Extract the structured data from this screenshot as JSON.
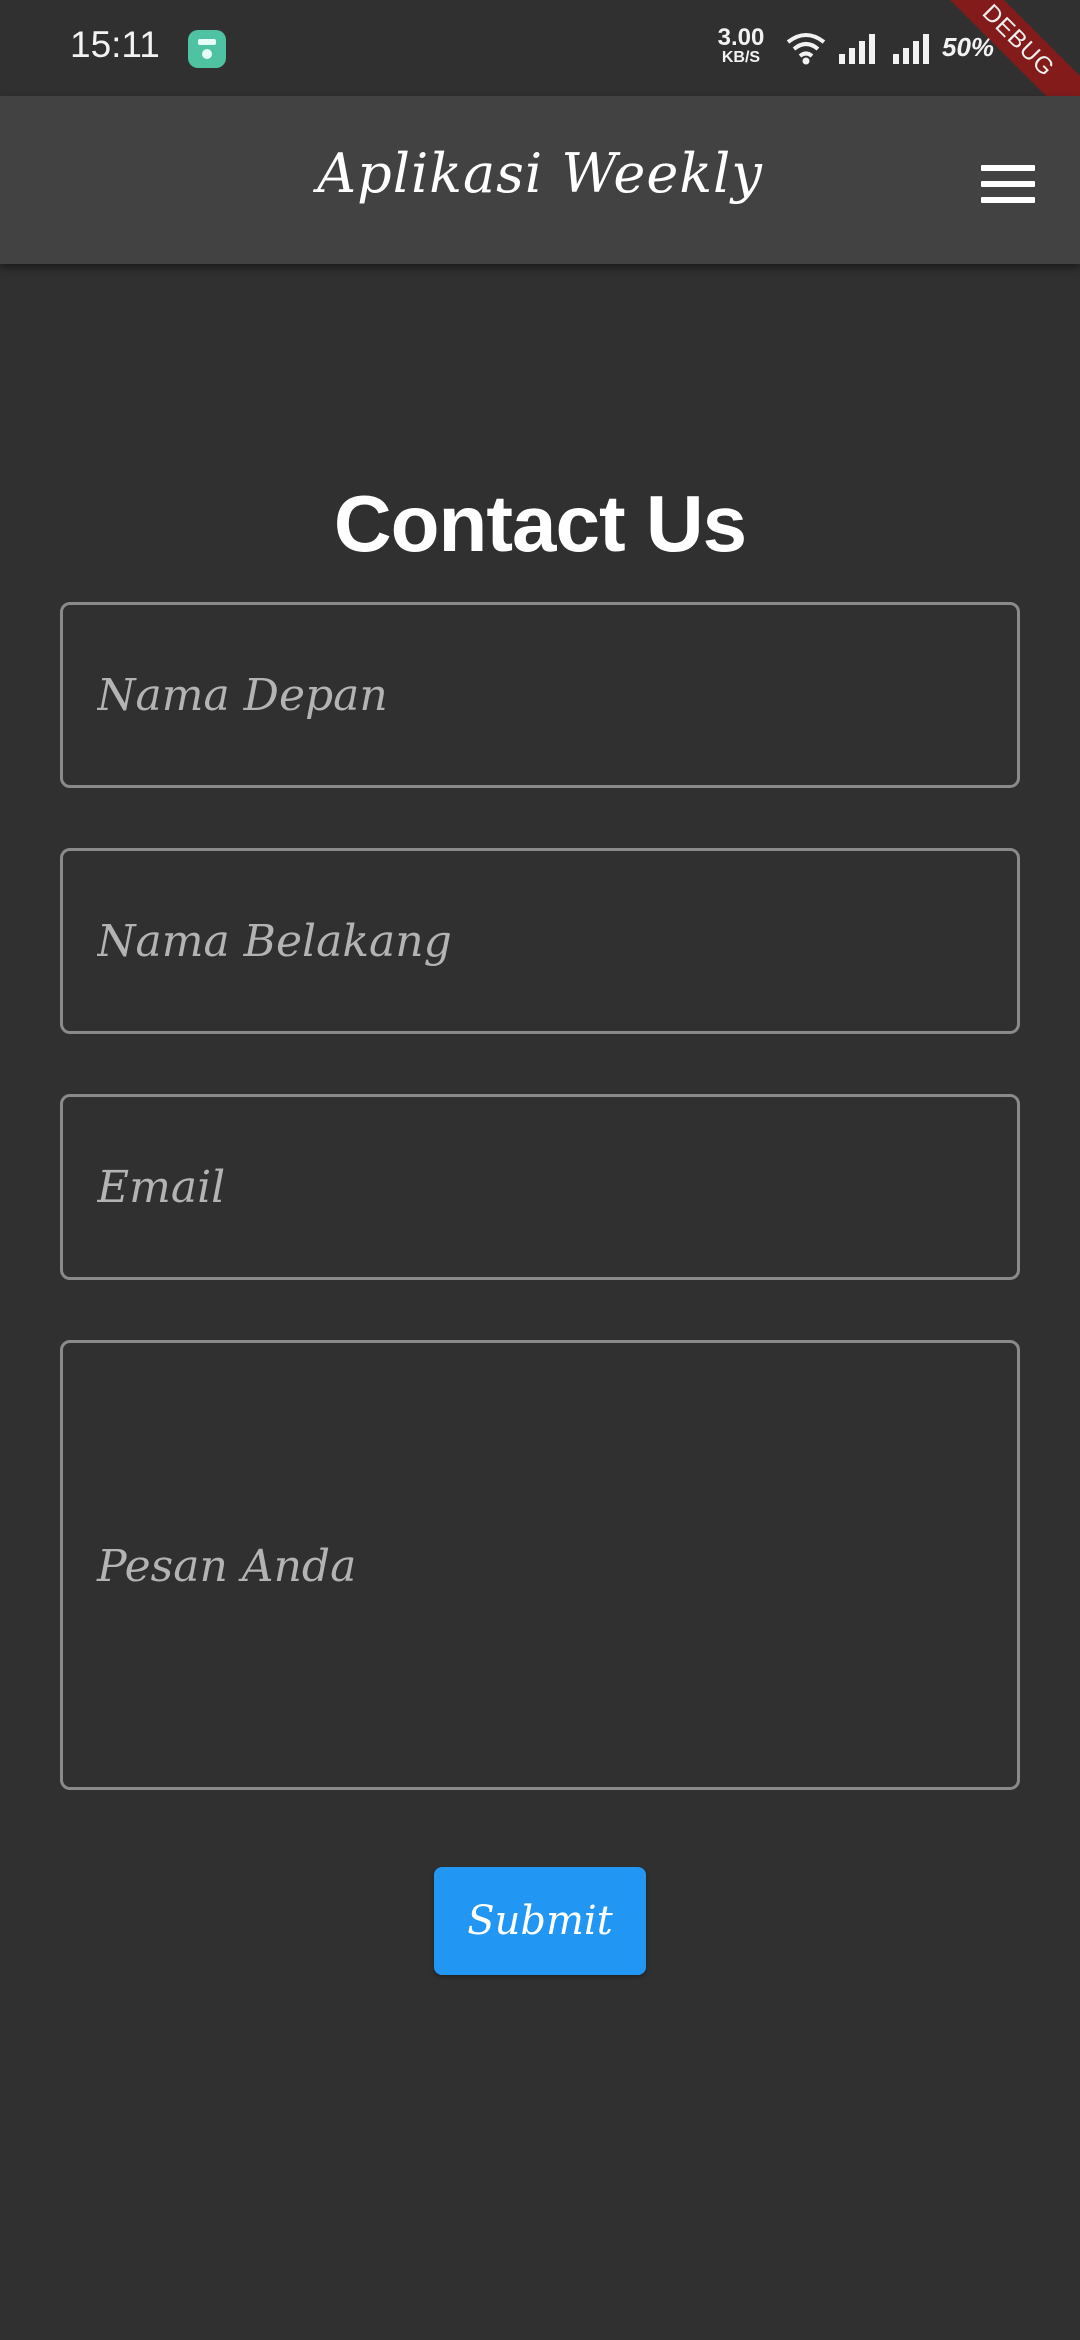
{
  "status_bar": {
    "time": "15:11",
    "net_speed_value": "3.00",
    "net_speed_unit": "KB/S",
    "battery": "50%",
    "debug_banner": "DEBUG"
  },
  "app_bar": {
    "title": "Aplikasi Weekly",
    "menu_icon": "hamburger-menu-icon"
  },
  "form": {
    "title": "Contact Us",
    "first_name_placeholder": "Nama Depan",
    "last_name_placeholder": "Nama Belakang",
    "email_placeholder": "Email",
    "message_placeholder": "Pesan Anda",
    "submit_label": "Submit"
  },
  "colors": {
    "background": "#303030",
    "app_bar": "#424242",
    "field_border": "#8a8a8a",
    "placeholder": "#b3b3b3",
    "button": "#2196f3"
  }
}
